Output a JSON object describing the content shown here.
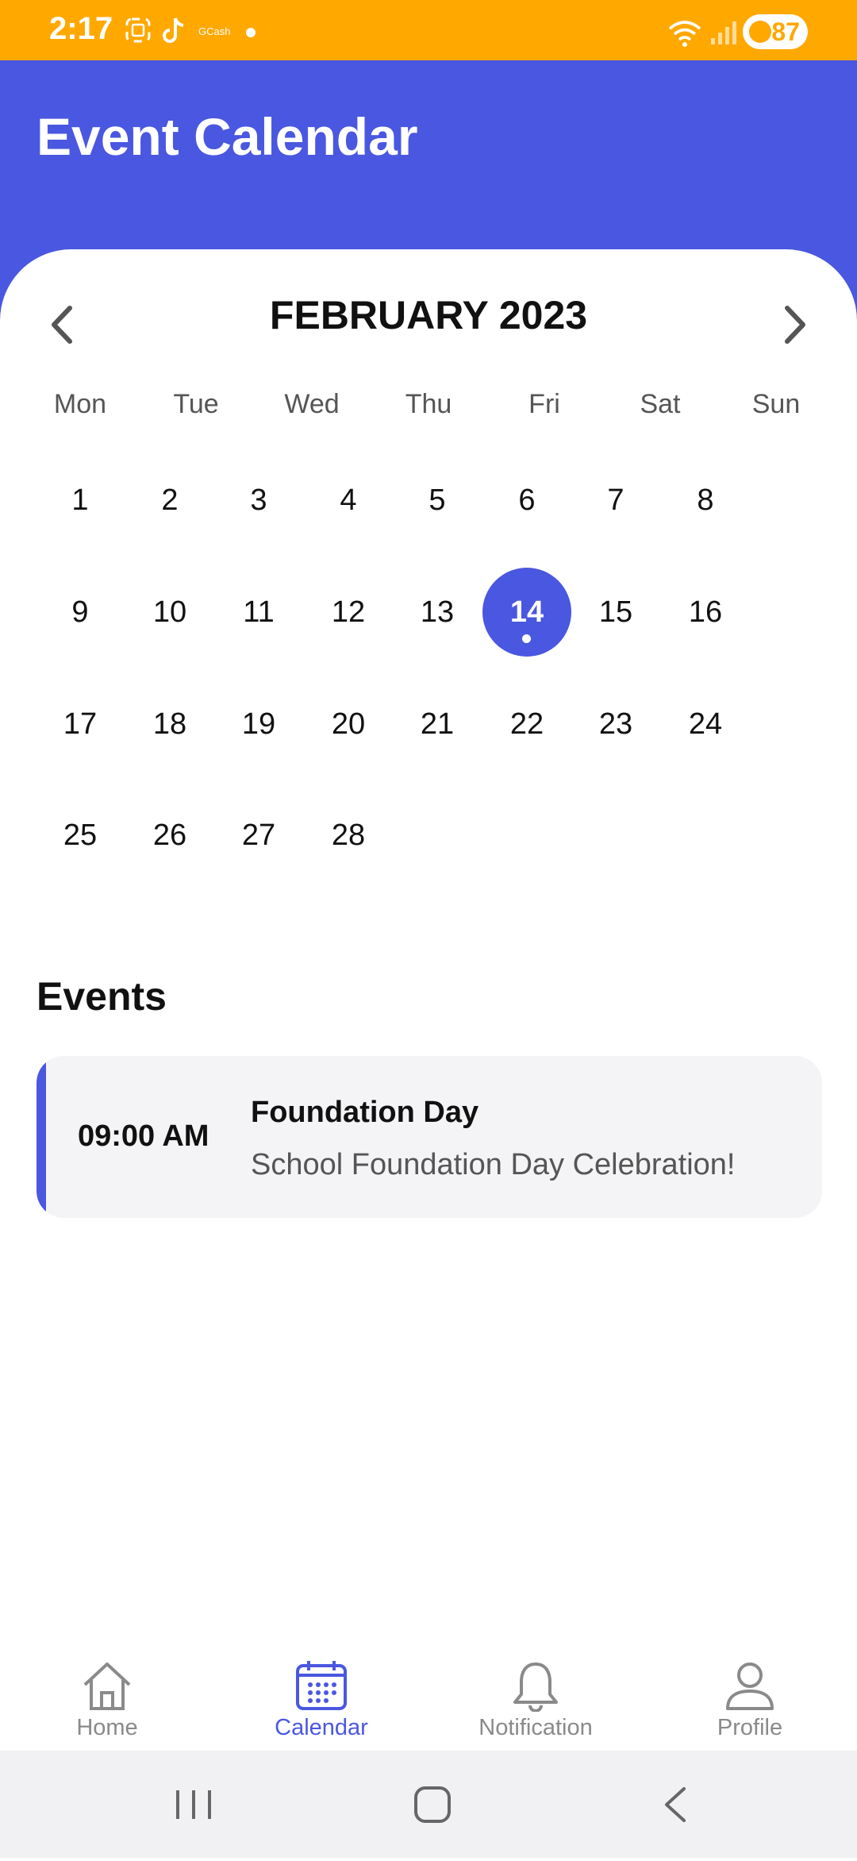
{
  "status_bar": {
    "time": "2:17",
    "gcash": "GCash",
    "battery": "87"
  },
  "header": {
    "title": "Event Calendar"
  },
  "calendar": {
    "month_label": "FEBRUARY 2023",
    "weekdays": [
      "Mon",
      "Tue",
      "Wed",
      "Thu",
      "Fri",
      "Sat",
      "Sun"
    ],
    "selected_day": "14",
    "weeks": [
      [
        "1",
        "2",
        "3",
        "4",
        "5",
        "6",
        "7",
        "8"
      ],
      [
        "9",
        "10",
        "11",
        "12",
        "13",
        "14",
        "15",
        "16"
      ],
      [
        "17",
        "18",
        "19",
        "20",
        "21",
        "22",
        "23",
        "24"
      ],
      [
        "25",
        "26",
        "27",
        "28"
      ]
    ]
  },
  "events": {
    "title": "Events",
    "items": [
      {
        "time": "09:00 AM",
        "name": "Foundation Day",
        "description": "School Foundation Day Celebration!"
      }
    ]
  },
  "bottom_nav": {
    "items": [
      {
        "label": "Home",
        "icon": "home-icon"
      },
      {
        "label": "Calendar",
        "icon": "calendar-icon",
        "active": true
      },
      {
        "label": "Notification",
        "icon": "bell-icon"
      },
      {
        "label": "Profile",
        "icon": "person-icon"
      }
    ]
  },
  "colors": {
    "accent": "#4A57E0",
    "status_bar": "#FFA800"
  }
}
